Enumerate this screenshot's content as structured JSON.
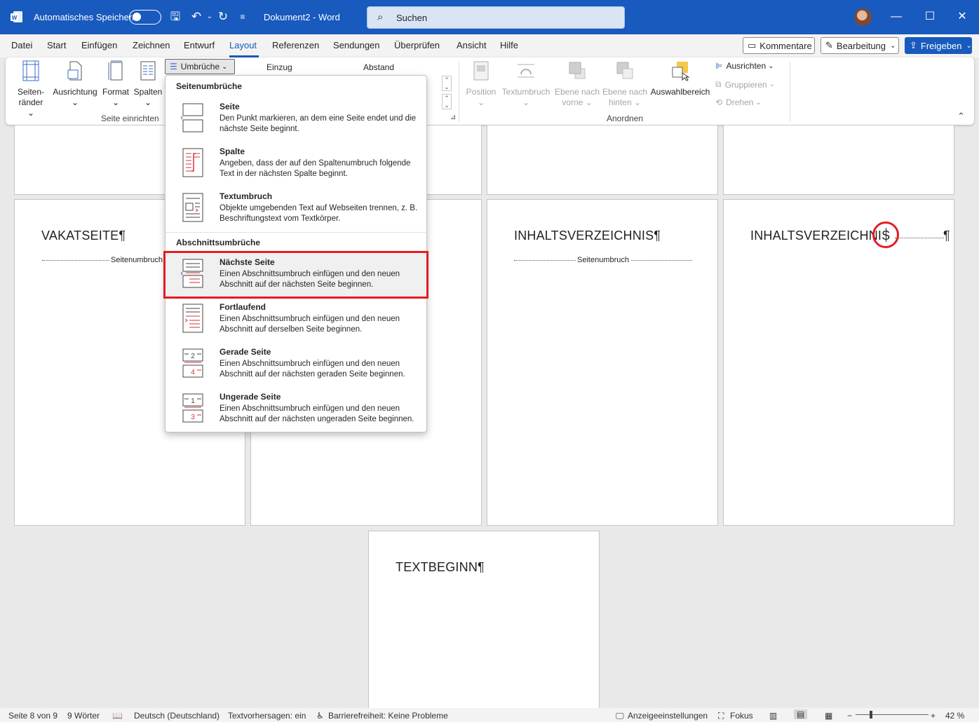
{
  "titlebar": {
    "autosave_label": "Automatisches Speichern",
    "doc_title": "Dokument2  -  Word",
    "search_placeholder": "Suchen"
  },
  "tabs": [
    "Datei",
    "Start",
    "Einfügen",
    "Zeichnen",
    "Entwurf",
    "Layout",
    "Referenzen",
    "Sendungen",
    "Überprüfen",
    "Ansicht",
    "Hilfe"
  ],
  "active_tab": "Layout",
  "top_buttons": {
    "comments": "Kommentare",
    "editing": "Bearbeitung",
    "share": "Freigeben"
  },
  "ribbon": {
    "seite_einrichten": {
      "label": "Seite einrichten",
      "items": [
        "Seiten-",
        "ränder",
        "Ausrichtung",
        "Format",
        "Spalten"
      ]
    },
    "umbrueche": "Umbrüche",
    "einzug": "Einzug",
    "abstand": "Abstand",
    "anordnen": {
      "label": "Anordnen",
      "position": "Position",
      "textumbruch": "Textumbruch",
      "ebene_vorne_1": "Ebene nach",
      "ebene_vorne_2": "vorne",
      "ebene_hinten_1": "Ebene nach",
      "ebene_hinten_2": "hinten",
      "auswahlbereich": "Auswahlbereich",
      "ausrichten": "Ausrichten",
      "gruppieren": "Gruppieren",
      "drehen": "Drehen"
    }
  },
  "dropdown": {
    "section1": "Seitenumbrüche",
    "section2": "Abschnittsumbrüche",
    "items": [
      {
        "title": "Seite",
        "desc": "Den Punkt markieren, an dem eine Seite endet und die nächste Seite beginnt."
      },
      {
        "title": "Spalte",
        "desc": "Angeben, dass der auf den Spaltenumbruch folgende Text in der nächsten Spalte beginnt."
      },
      {
        "title": "Textumbruch",
        "desc": "Objekte umgebenden Text auf Webseiten trennen, z. B. Beschriftungstext vom Textkörper."
      },
      {
        "title": "Nächste Seite",
        "desc": "Einen Abschnittsumbruch einfügen und den neuen Abschnitt auf der nächsten Seite beginnen."
      },
      {
        "title": "Fortlaufend",
        "desc": "Einen Abschnittsumbruch einfügen und den neuen Abschnitt auf derselben Seite beginnen."
      },
      {
        "title": "Gerade Seite",
        "desc": "Einen Abschnittsumbruch einfügen und den neuen Abschnitt auf der nächsten geraden Seite beginnen."
      },
      {
        "title": "Ungerade Seite",
        "desc": "Einen Abschnittsumbruch einfügen und den neuen Abschnitt auf der nächsten ungeraden Seite beginnen."
      }
    ]
  },
  "document": {
    "vakatseite": "VAKATSEITE¶",
    "inhaltsverzeichnis1": "INHALTSVERZEICHNIS¶",
    "inhaltsverzeichnis2": "INHALTSVERZEICHNIS",
    "pilcrow": "¶",
    "textbeginn": "TEXTBEGINN¶",
    "seitenumbruch": "Seitenumbruch"
  },
  "statusbar": {
    "page": "Seite 8 von 9",
    "words": "9 Wörter",
    "language": "Deutsch (Deutschland)",
    "textpredictions": "Textvorhersagen: ein",
    "accessibility": "Barrierefreiheit: Keine Probleme",
    "display_settings": "Anzeigeeinstellungen",
    "focus": "Fokus",
    "zoom_minus": "−",
    "zoom_plus": "+",
    "zoom": "42 %"
  }
}
